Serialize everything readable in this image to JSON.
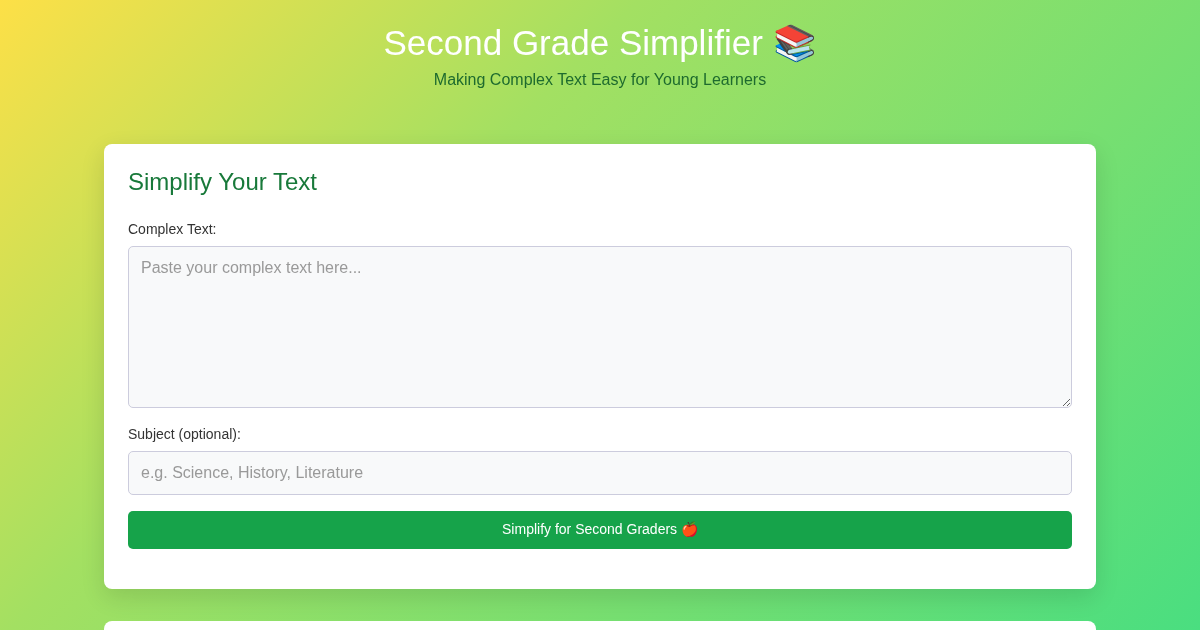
{
  "header": {
    "title": "Second Grade Simplifier 📚",
    "subtitle": "Making Complex Text Easy for Young Learners"
  },
  "form": {
    "heading": "Simplify Your Text",
    "fields": [
      {
        "kind": "textarea",
        "label": "Complex Text:",
        "placeholder": "Paste your complex text here..."
      },
      {
        "kind": "input",
        "label": "Subject (optional):",
        "placeholder": "e.g. Science, History, Literature"
      }
    ],
    "button": "Simplify for Second Graders 🍎"
  }
}
